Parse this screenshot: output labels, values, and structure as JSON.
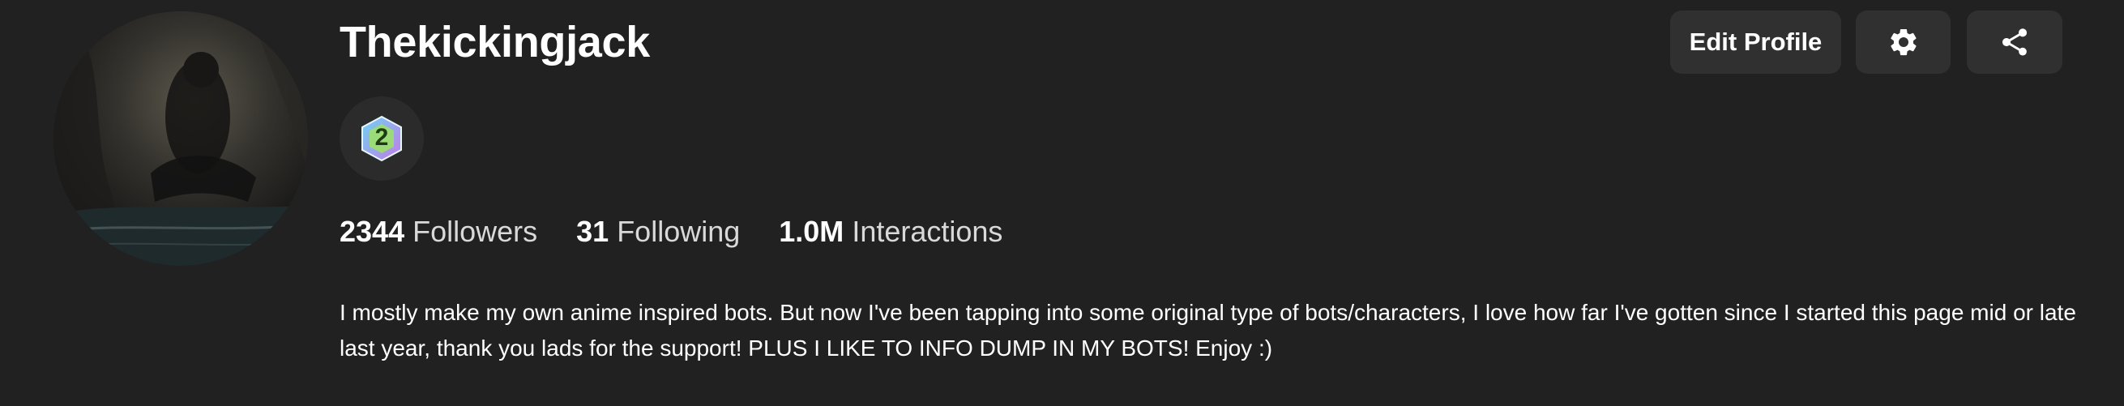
{
  "profile": {
    "username": "Thekickingjack",
    "badge_level": "2",
    "stats": {
      "followers_count": "2344",
      "followers_label": "Followers",
      "following_count": "31",
      "following_label": "Following",
      "interactions_count": "1.0M",
      "interactions_label": "Interactions"
    },
    "bio": "I mostly make my own anime inspired bots. But now I've been tapping into some original type of bots/characters, I love how far I've gotten since I started this page mid or late last year, thank you lads for the support! PLUS I LIKE TO INFO DUMP IN MY BOTS! Enjoy :)"
  },
  "actions": {
    "edit_label": "Edit Profile",
    "settings_icon": "gear-icon",
    "share_icon": "share-icon"
  },
  "colors": {
    "background": "#212121",
    "button_bg": "#303030",
    "text": "#ffffff",
    "badge_gradient": [
      "#6fd3f2",
      "#c27be8"
    ]
  }
}
